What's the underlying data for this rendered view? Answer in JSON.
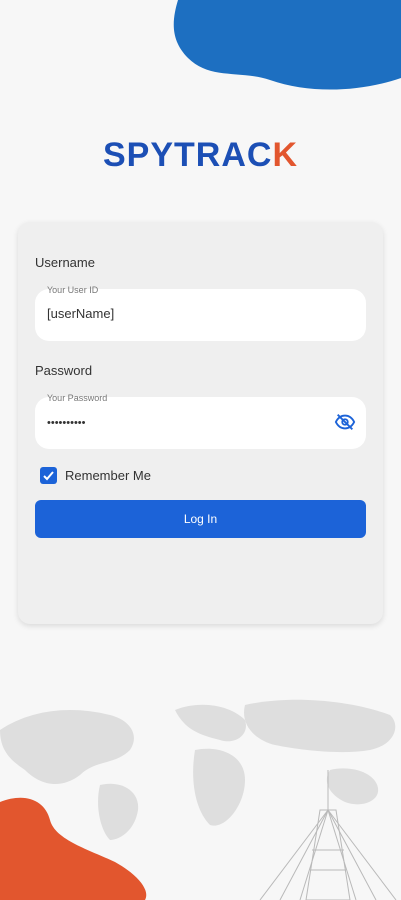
{
  "logo": {
    "text_main": "SPYTRAC",
    "text_accent": "K"
  },
  "form": {
    "username_label": "Username",
    "username_caption": "Your User ID",
    "username_value": "[userName]",
    "password_label": "Password",
    "password_caption": "Your Password",
    "password_value": "••••••••••",
    "remember_label": "Remember Me",
    "remember_checked": true,
    "login_label": "Log In"
  },
  "colors": {
    "brand_blue": "#1c63d8",
    "logo_blue": "#1c4fb5",
    "accent_orange": "#e2562e",
    "blob_blue": "#1d6fc1"
  }
}
